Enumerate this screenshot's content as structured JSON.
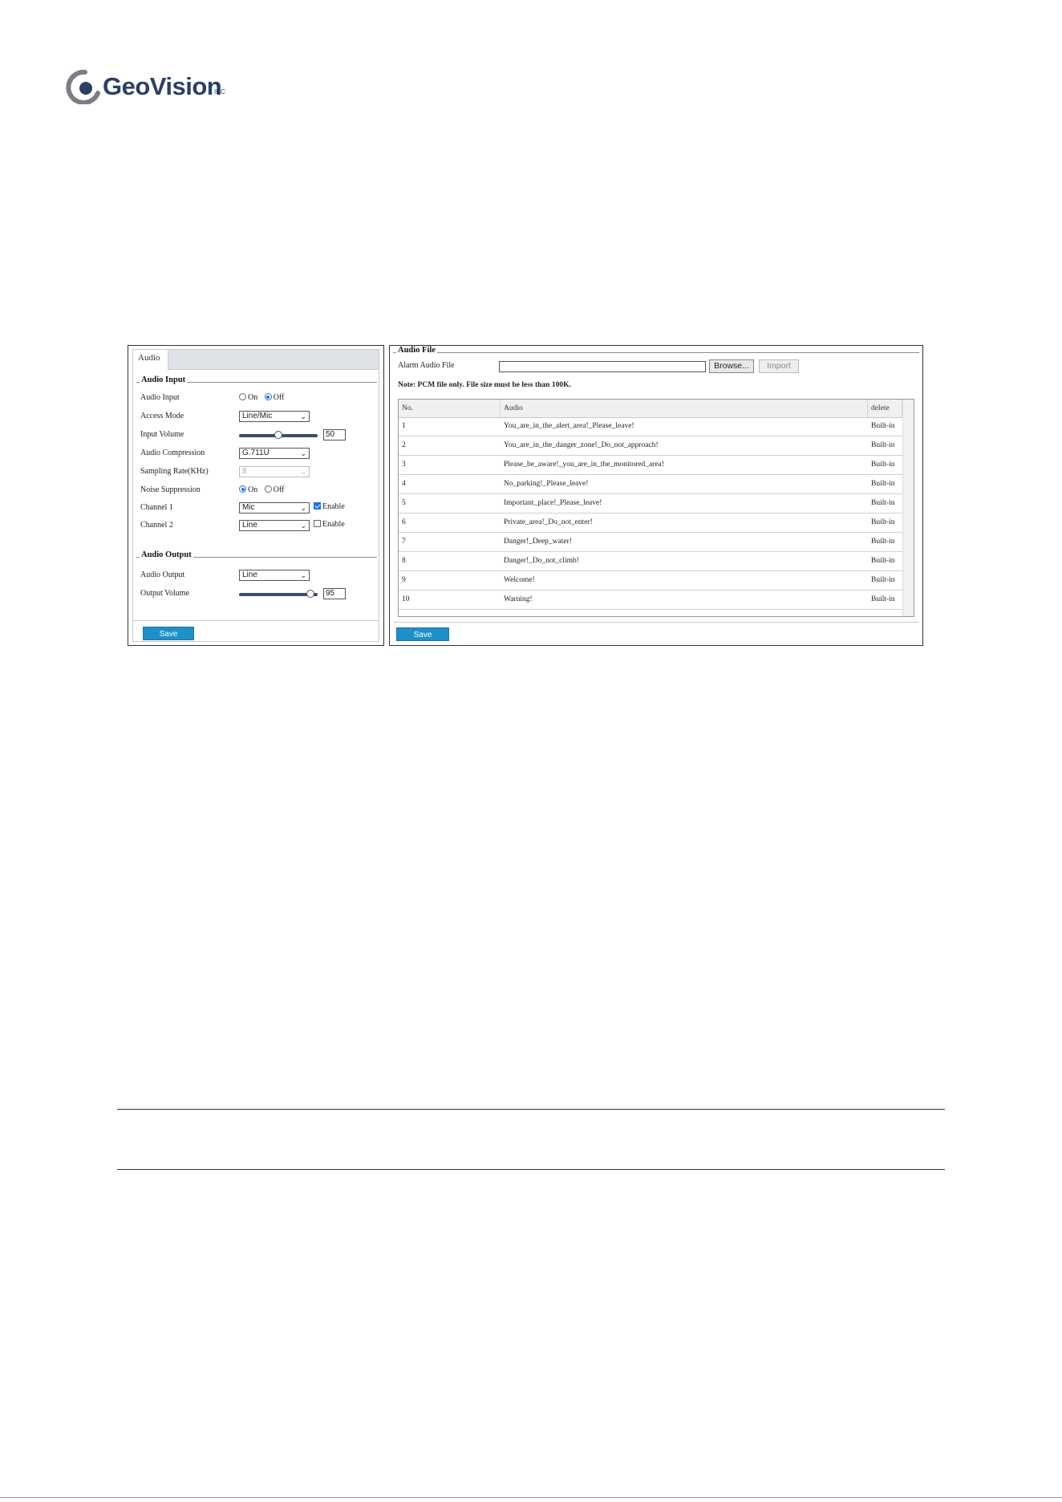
{
  "brand": {
    "name": "GeoVision",
    "reg": "INC"
  },
  "audio_panel": {
    "tab_label": "Audio",
    "input_section": {
      "legend": "Audio Input",
      "audio_input": {
        "label": "Audio Input",
        "on": "On",
        "off": "Off",
        "selected": "Off"
      },
      "access_mode": {
        "label": "Access Mode",
        "value": "Line/Mic"
      },
      "input_volume": {
        "label": "Input Volume",
        "value": "50",
        "fraction": 0.5
      },
      "audio_compression": {
        "label": "Audio Compression",
        "value": "G.711U"
      },
      "sampling_rate": {
        "label": "Sampling Rate(KHz)",
        "value": "8"
      },
      "noise_suppression": {
        "label": "Noise Suppression",
        "on": "On",
        "off": "Off",
        "selected": "On"
      },
      "channel_1": {
        "label": "Channel 1",
        "value": "Mic",
        "enable_label": "Enable",
        "enabled": true
      },
      "channel_2": {
        "label": "Channel 2",
        "value": "Line",
        "enable_label": "Enable",
        "enabled": false
      }
    },
    "output_section": {
      "legend": "Audio Output",
      "audio_output": {
        "label": "Audio Output",
        "value": "Line"
      },
      "output_volume": {
        "label": "Output Volume",
        "value": "95",
        "fraction": 0.95
      }
    },
    "save_label": "Save"
  },
  "audio_file_panel": {
    "legend": "Audio File",
    "alarm_label": "Alarm Audio File",
    "browse_label": "Browse...",
    "import_label": "Import",
    "note": "Note: PCM file only. File size must be less than 100K.",
    "columns": [
      "No.",
      "Audio",
      "delete"
    ],
    "rows": [
      {
        "no": "1",
        "audio": "You_are_in_the_alert_area!_Please_leave!",
        "delete": "Built-in"
      },
      {
        "no": "2",
        "audio": "You_are_in_the_danger_zone!_Do_not_approach!",
        "delete": "Built-in"
      },
      {
        "no": "3",
        "audio": "Please_be_aware!_you_are_in_the_monitored_area!",
        "delete": "Built-in"
      },
      {
        "no": "4",
        "audio": "No_parking!_Please_leave!",
        "delete": "Built-in"
      },
      {
        "no": "5",
        "audio": "Important_place!_Please_leave!",
        "delete": "Built-in"
      },
      {
        "no": "6",
        "audio": "Private_area!_Do_not_enter!",
        "delete": "Built-in"
      },
      {
        "no": "7",
        "audio": "Danger!_Deep_water!",
        "delete": "Built-in"
      },
      {
        "no": "8",
        "audio": "Danger!_Do_not_climb!",
        "delete": "Built-in"
      },
      {
        "no": "9",
        "audio": "Welcome!",
        "delete": "Built-in"
      },
      {
        "no": "10",
        "audio": "Warning!",
        "delete": "Built-in"
      }
    ],
    "save_label": "Save"
  },
  "colors": {
    "accent": "#1e90c9",
    "brand": "#2b3f63",
    "slider": "#3b4d6b"
  }
}
